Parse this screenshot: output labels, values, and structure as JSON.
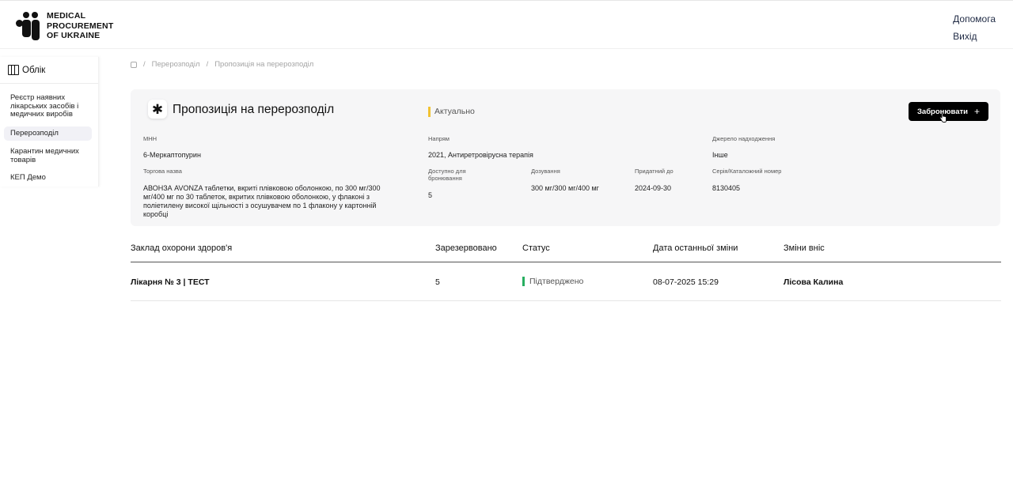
{
  "brand": {
    "logo_lines": [
      "MEDICAL",
      "PROCUREMENT",
      "OF UKRAINE"
    ]
  },
  "header": {
    "help": "Допомога",
    "logout": "Вихід"
  },
  "sidebar": {
    "title": "Облік",
    "items": [
      {
        "label": "Реєстр наявних лікарських засобів і медичних виробів",
        "active": false
      },
      {
        "label": "Перерозподіл",
        "active": true
      },
      {
        "label": "Карантин медичних товарів",
        "active": false
      },
      {
        "label": "КЕП Демо",
        "active": false
      }
    ]
  },
  "breadcrumb": {
    "items": [
      "Перерозподіл",
      "Пропозиція на перерозподіл"
    ]
  },
  "card": {
    "icon": "asterisk-icon",
    "title": "Пропозиція на перерозподіл",
    "status": "Актуально",
    "status_color": "#f1c232",
    "book_button": "Забронювати",
    "fields": {
      "mnn_label": "МНН",
      "mnn_value": "6-Меркаптопурин",
      "direction_label": "Напрям",
      "direction_value": "2021, Антиретровірусна терапія",
      "source_label": "Джерело надходження",
      "source_value": "Інше",
      "trade_label": "Торгова назва",
      "trade_value": "АВОНЗА AVONZA таблетки, вкриті плівковою оболонкою, по 300 мг/300 мг/400 мг по 30 таблеток, вкритих плівковою оболонкою, у флаконі з поліетилену високої щільності з осушувачем по 1 флакону у картонній коробці",
      "available_label": "Доступно для бронювання",
      "available_value": "5",
      "dosage_label": "Дозування",
      "dosage_value": "300 мг/300 мг/400 мг",
      "valid_label": "Придатний до",
      "valid_value": "2024-09-30",
      "series_label": "Серія/Каталожний номер",
      "series_value": "8130405"
    }
  },
  "table": {
    "headers": [
      "Заклад охорони здоров'я",
      "Зарезервовано",
      "Статус",
      "Дата останньої зміни",
      "Зміни вніс"
    ],
    "rows": [
      {
        "facility": "Лікарня № 3 | ТЕСТ",
        "reserved": "5",
        "status": "Підтверджено",
        "status_color": "#27ae60",
        "date": "08-07-2025 15:29",
        "author": "Лісова Калина"
      }
    ]
  }
}
